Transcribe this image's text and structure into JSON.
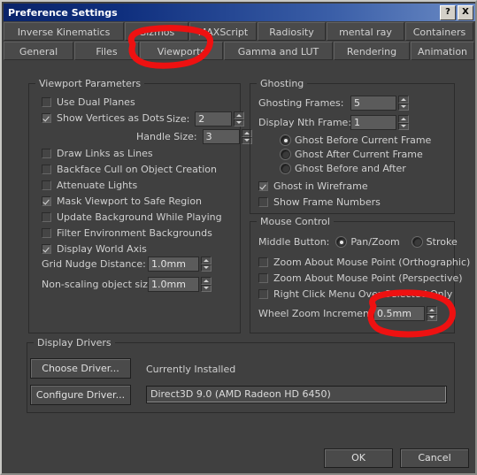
{
  "window": {
    "title": "Preference Settings",
    "help_button": "?",
    "close_button": "X"
  },
  "tabs": {
    "row1": [
      {
        "label": "Inverse Kinematics",
        "active": false
      },
      {
        "label": "Gizmos",
        "active": false
      },
      {
        "label": "MAXScript",
        "active": false
      },
      {
        "label": "Radiosity",
        "active": false
      },
      {
        "label": "mental ray",
        "active": false
      },
      {
        "label": "Containers",
        "active": false
      }
    ],
    "row2": [
      {
        "label": "General",
        "active": false
      },
      {
        "label": "Files",
        "active": false
      },
      {
        "label": "Viewports",
        "active": true
      },
      {
        "label": "Gamma and LUT",
        "active": false
      },
      {
        "label": "Rendering",
        "active": false
      },
      {
        "label": "Animation",
        "active": false
      }
    ]
  },
  "viewport_parameters": {
    "title": "Viewport Parameters",
    "checkboxes": [
      {
        "label": "Use Dual Planes",
        "checked": false
      },
      {
        "label": "Show Vertices as Dots",
        "checked": true
      },
      {
        "label": "Draw Links as Lines",
        "checked": false
      },
      {
        "label": "Backface Cull on Object Creation",
        "checked": false
      },
      {
        "label": "Attenuate Lights",
        "checked": false
      },
      {
        "label": "Mask Viewport to Safe Region",
        "checked": true
      },
      {
        "label": "Update Background While Playing",
        "checked": false
      },
      {
        "label": "Filter Environment Backgrounds",
        "checked": false
      },
      {
        "label": "Display World Axis",
        "checked": true
      }
    ],
    "size_label": "Size:",
    "size_value": "2",
    "handle_size_label": "Handle Size:",
    "handle_size_value": "3",
    "grid_nudge_label": "Grid Nudge Distance:",
    "grid_nudge_value": "1.0mm",
    "non_scaling_label": "Non-scaling object size:",
    "non_scaling_value": "1.0mm"
  },
  "ghosting": {
    "title": "Ghosting",
    "frames_label": "Ghosting Frames:",
    "frames_value": "5",
    "nth_frame_label": "Display Nth Frame:",
    "nth_frame_value": "1",
    "radios": [
      {
        "label": "Ghost Before Current Frame",
        "selected": true
      },
      {
        "label": "Ghost After Current Frame",
        "selected": false
      },
      {
        "label": "Ghost Before and After",
        "selected": false
      }
    ],
    "checkboxes": [
      {
        "label": "Ghost in Wireframe",
        "checked": true
      },
      {
        "label": "Show Frame Numbers",
        "checked": false
      }
    ]
  },
  "mouse_control": {
    "title": "Mouse Control",
    "middle_button_label": "Middle Button:",
    "middle_button_options": [
      {
        "label": "Pan/Zoom",
        "selected": true
      },
      {
        "label": "Stroke",
        "selected": false
      }
    ],
    "checkboxes": [
      {
        "label": "Zoom About Mouse Point (Orthographic)",
        "checked": false
      },
      {
        "label": "Zoom About Mouse Point (Perspective)",
        "checked": false
      },
      {
        "label": "Right Click Menu Over Selected Only",
        "checked": false
      }
    ],
    "wheel_zoom_label": "Wheel Zoom Increment",
    "wheel_zoom_value": "0.5mm"
  },
  "display_drivers": {
    "title": "Display Drivers",
    "choose_driver_button": "Choose Driver...",
    "configure_driver_button": "Configure Driver...",
    "currently_installed_label": "Currently Installed",
    "driver_value": "Direct3D 9.0 (AMD Radeon HD 6450)"
  },
  "footer": {
    "ok_button": "OK",
    "cancel_button": "Cancel"
  },
  "annotations": {
    "color": "#ee1111",
    "marks": [
      {
        "name": "viewports-tab-circle"
      },
      {
        "name": "wheel-zoom-increment-circle"
      }
    ]
  }
}
